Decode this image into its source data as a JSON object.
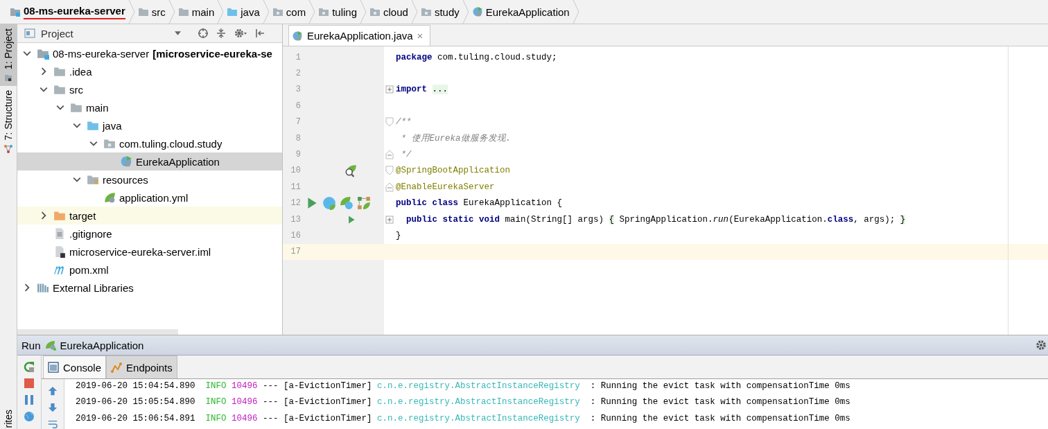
{
  "breadcrumbs": [
    {
      "label": "08-ms-eureka-server",
      "kind": "module",
      "underlined": true
    },
    {
      "label": "src",
      "kind": "folder",
      "underlined": false
    },
    {
      "label": "main",
      "kind": "folder",
      "underlined": false
    },
    {
      "label": "java",
      "kind": "source_root",
      "underlined": false
    },
    {
      "label": "com",
      "kind": "package",
      "underlined": false
    },
    {
      "label": "tuling",
      "kind": "package",
      "underlined": false
    },
    {
      "label": "cloud",
      "kind": "package",
      "underlined": false
    },
    {
      "label": "study",
      "kind": "package",
      "underlined": false
    },
    {
      "label": "EurekaApplication",
      "kind": "spring_class",
      "underlined": false
    }
  ],
  "side_tabs": [
    {
      "label": "1: Project",
      "kind": "project",
      "selected": true
    },
    {
      "label": "7: Structure",
      "kind": "structure",
      "selected": false
    }
  ],
  "bottom_side_tab": {
    "label": "rites"
  },
  "project_panel": {
    "title": "Project",
    "tree": [
      {
        "label": "08-ms-eureka-server",
        "suffix": "[microservice-eureka-se",
        "kind": "module",
        "expanded": true,
        "selected": false,
        "highlighted": false,
        "children": [
          {
            "label": ".idea",
            "kind": "folder",
            "expanded": false,
            "selected": false,
            "highlighted": false
          },
          {
            "label": "src",
            "kind": "folder",
            "expanded": true,
            "selected": false,
            "highlighted": false,
            "children": [
              {
                "label": "main",
                "kind": "folder",
                "expanded": true,
                "selected": false,
                "highlighted": false,
                "children": [
                  {
                    "label": "java",
                    "kind": "source_root",
                    "expanded": true,
                    "selected": false,
                    "highlighted": false,
                    "children": [
                      {
                        "label": "com.tuling.cloud.study",
                        "kind": "package",
                        "expanded": true,
                        "selected": false,
                        "highlighted": false,
                        "children": [
                          {
                            "label": "EurekaApplication",
                            "kind": "spring_class",
                            "selected": true,
                            "highlighted": false
                          }
                        ]
                      }
                    ]
                  },
                  {
                    "label": "resources",
                    "kind": "resource_root",
                    "expanded": true,
                    "selected": false,
                    "highlighted": false,
                    "children": [
                      {
                        "label": "application.yml",
                        "kind": "yaml",
                        "selected": false,
                        "highlighted": false
                      }
                    ]
                  }
                ]
              }
            ]
          },
          {
            "label": "target",
            "kind": "excluded_folder",
            "expanded": false,
            "selected": false,
            "highlighted": true
          },
          {
            "label": ".gitignore",
            "kind": "text_file",
            "selected": false,
            "highlighted": false
          },
          {
            "label": "microservice-eureka-server.iml",
            "kind": "iml_file",
            "selected": false,
            "highlighted": false
          },
          {
            "label": "pom.xml",
            "kind": "maven",
            "selected": false,
            "highlighted": false
          }
        ]
      },
      {
        "label": "External Libraries",
        "kind": "libraries",
        "expanded": false,
        "selected": false,
        "highlighted": false
      }
    ]
  },
  "editor": {
    "tabs": [
      {
        "label": "EurekaApplication.java",
        "close": "×",
        "selected": true
      }
    ],
    "lines": [
      {
        "number": "1",
        "current": false,
        "segments": [
          {
            "text": "package ",
            "kind": "keyword"
          },
          {
            "text": "com.tuling.cloud.study;",
            "kind": "plain"
          }
        ]
      },
      {
        "number": "2",
        "current": false
      },
      {
        "number": "3",
        "fold": {
          "kind": "plus"
        },
        "current": false,
        "segments": [
          {
            "text": "import ",
            "kind": "keyword"
          },
          {
            "text": "...",
            "kind": "folded"
          }
        ]
      },
      {
        "number": "6",
        "current": false
      },
      {
        "number": "7",
        "fold": {
          "kind": "open"
        },
        "current": false,
        "segments": [
          {
            "text": "/**",
            "kind": "comment"
          }
        ]
      },
      {
        "number": "8",
        "current": false,
        "segments": [
          {
            "text": " * 使用Eureka做服务发现.",
            "kind": "comment"
          }
        ]
      },
      {
        "number": "9",
        "fold": {
          "kind": "close"
        },
        "current": false,
        "segments": [
          {
            "text": " */",
            "kind": "comment"
          }
        ]
      },
      {
        "number": "10",
        "fold": {
          "kind": "open"
        },
        "gutter": [
          {
            "kind": "spring_search"
          }
        ],
        "current": false,
        "segments": [
          {
            "text": "@SpringBootApplication",
            "kind": "annotation"
          }
        ]
      },
      {
        "number": "11",
        "fold": {
          "kind": "close"
        },
        "current": false,
        "segments": [
          {
            "text": "@EnableEurekaServer",
            "kind": "annotation"
          }
        ]
      },
      {
        "number": "12",
        "gutter": [
          {
            "kind": "run"
          },
          {
            "kind": "class"
          },
          {
            "kind": "spring_class"
          },
          {
            "kind": "bean_graph"
          }
        ],
        "current": false,
        "segments": [
          {
            "text": "public class",
            "kind": "keyword"
          },
          {
            "text": " EurekaApplication {",
            "kind": "plain"
          }
        ]
      },
      {
        "number": "13",
        "fold": {
          "kind": "plus"
        },
        "gutter": [
          {
            "kind": "run_indent"
          }
        ],
        "current": false,
        "segments": [
          {
            "text": "  public static void",
            "kind": "keyword"
          },
          {
            "text": " main(String[] args) ",
            "kind": "plain"
          },
          {
            "text": "{",
            "kind": "folded"
          },
          {
            "text": " SpringApplication.",
            "kind": "plain"
          },
          {
            "text": "run",
            "kind": "italic"
          },
          {
            "text": "(EurekaApplication.",
            "kind": "plain"
          },
          {
            "text": "class",
            "kind": "keyword"
          },
          {
            "text": ", args); ",
            "kind": "plain"
          },
          {
            "text": "}",
            "kind": "folded"
          }
        ]
      },
      {
        "number": "16",
        "current": false,
        "segments": [
          {
            "text": "}",
            "kind": "plain"
          }
        ]
      },
      {
        "number": "17",
        "current": true
      }
    ]
  },
  "run_panel": {
    "label": "Run",
    "config": "EurekaApplication",
    "tabs": [
      {
        "label": "Console",
        "kind": "console",
        "selected": true
      },
      {
        "label": "Endpoints",
        "kind": "endpoints",
        "selected": false
      }
    ],
    "console": [
      [
        {
          "text": "2019-06-20 15:04:54.890  ",
          "kind": "plain"
        },
        {
          "text": "INFO ",
          "kind": "level"
        },
        {
          "text": "10496",
          "kind": "pid"
        },
        {
          "text": " --- [a-EvictionTimer] ",
          "kind": "plain"
        },
        {
          "text": "c.n.e.registry.AbstractInstanceRegistry",
          "kind": "logger"
        },
        {
          "text": "  : Running the evict task with compensationTime 0ms",
          "kind": "plain"
        }
      ],
      [
        {
          "text": "2019-06-20 15:05:54.890  ",
          "kind": "plain"
        },
        {
          "text": "INFO ",
          "kind": "level"
        },
        {
          "text": "10496",
          "kind": "pid"
        },
        {
          "text": " --- [a-EvictionTimer] ",
          "kind": "plain"
        },
        {
          "text": "c.n.e.registry.AbstractInstanceRegistry",
          "kind": "logger"
        },
        {
          "text": "  : Running the evict task with compensationTime 0ms",
          "kind": "plain"
        }
      ],
      [
        {
          "text": "2019-06-20 15:06:54.891  ",
          "kind": "plain"
        },
        {
          "text": "INFO ",
          "kind": "level"
        },
        {
          "text": "10496",
          "kind": "pid"
        },
        {
          "text": " --- [a-EvictionTimer] ",
          "kind": "plain"
        },
        {
          "text": "c.n.e.registry.AbstractInstanceRegistry",
          "kind": "logger"
        },
        {
          "text": "  : Running the evict task with compensationTime 0ms",
          "kind": "plain"
        }
      ]
    ]
  }
}
